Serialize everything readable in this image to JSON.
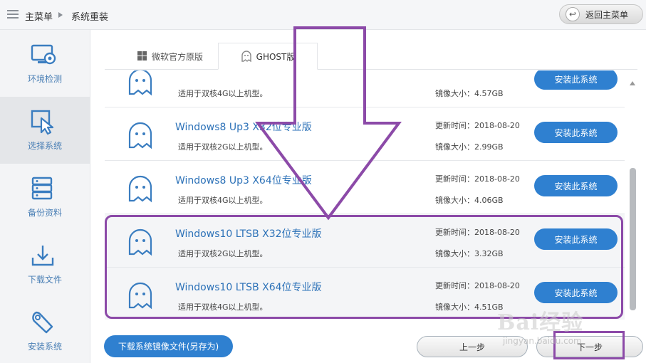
{
  "breadcrumb": {
    "home": "主菜单",
    "current": "系统重装"
  },
  "back_button": {
    "label": "返回主菜单"
  },
  "sidebar": {
    "items": [
      {
        "label": "环境检测",
        "icon": "monitor-gear-icon",
        "active": false
      },
      {
        "label": "选择系统",
        "icon": "cursor-select-icon",
        "active": true
      },
      {
        "label": "备份资料",
        "icon": "database-icon",
        "active": false
      },
      {
        "label": "下载文件",
        "icon": "download-icon",
        "active": false
      },
      {
        "label": "安装系统",
        "icon": "wrench-icon",
        "active": false
      }
    ]
  },
  "tabs": [
    {
      "label": "微软官方原版",
      "icon": "windows-logo-icon",
      "active": false
    },
    {
      "label": "GHOST版",
      "icon": "ghost-icon",
      "active": true
    }
  ],
  "systems": [
    {
      "title": "",
      "desc": "适用于双核4G以上机型。",
      "time": "",
      "size": "镜像大小：4.57GB",
      "button": "安装此系统",
      "highlighted": false
    },
    {
      "title": "Windows8 Up3 X32位专业版",
      "desc": "适用于双核2G以上机型。",
      "time": "更新时间：2018-08-20",
      "size": "镜像大小：2.99GB",
      "button": "安装此系统",
      "highlighted": false
    },
    {
      "title": "Windows8 Up3 X64位专业版",
      "desc": "适用于双核4G以上机型。",
      "time": "更新时间：2018-08-20",
      "size": "镜像大小：4.06GB",
      "button": "安装此系统",
      "highlighted": false
    },
    {
      "title": "Windows10 LTSB X32位专业版",
      "desc": "适用于双核2G以上机型。",
      "time": "更新时间：2018-08-20",
      "size": "镜像大小：3.32GB",
      "button": "安装此系统",
      "highlighted": true
    },
    {
      "title": "Windows10 LTSB X64位专业版",
      "desc": "适用于双核4G以上机型。",
      "time": "更新时间：2018-08-20",
      "size": "镜像大小：4.51GB",
      "button": "安装此系统",
      "highlighted": true
    }
  ],
  "footer": {
    "download_label": "下载系统镜像文件(另存为)",
    "prev_label": "上一步",
    "next_label": "下一步"
  },
  "watermark": {
    "brand": "Bai经验",
    "url": "jingyan.baidu.com"
  },
  "colors": {
    "accent": "#2f80d0",
    "annotation": "#8c4aa8",
    "link": "#2d72b8"
  }
}
